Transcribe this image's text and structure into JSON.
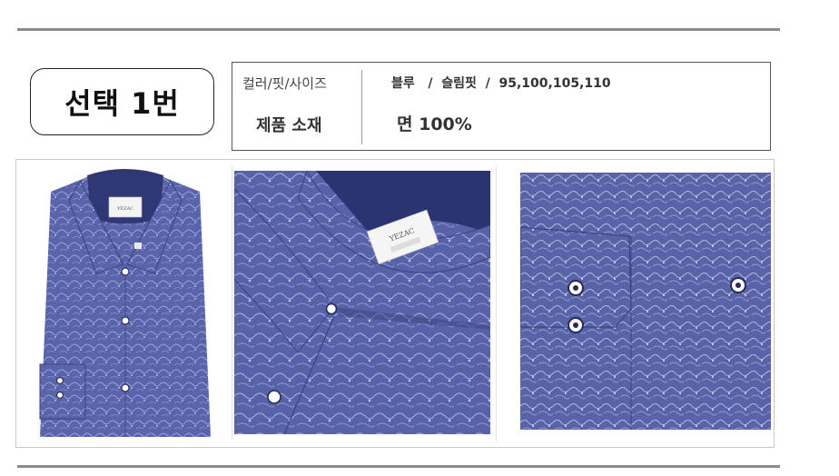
{
  "option": {
    "label": "선택 1번"
  },
  "spec": {
    "color_fit_size_label": "컬러/핏/사이즈",
    "color_fit_size_value": "블루   /  슬림핏  /  95,100,105,110",
    "material_label": "제품 소재",
    "material_value": "면 100%"
  },
  "photos": [
    {
      "name": "shirt-front-photo",
      "brand_tag": "YEZAC"
    },
    {
      "name": "shirt-collar-closeup-photo",
      "brand_tag": "YEZAC"
    },
    {
      "name": "shirt-cuff-closeup-photo"
    }
  ],
  "colors": {
    "fabric": "#5560a6",
    "fabric_dark": "#333c7a",
    "button": "#ffffff",
    "rule": "#8a8a8a"
  }
}
